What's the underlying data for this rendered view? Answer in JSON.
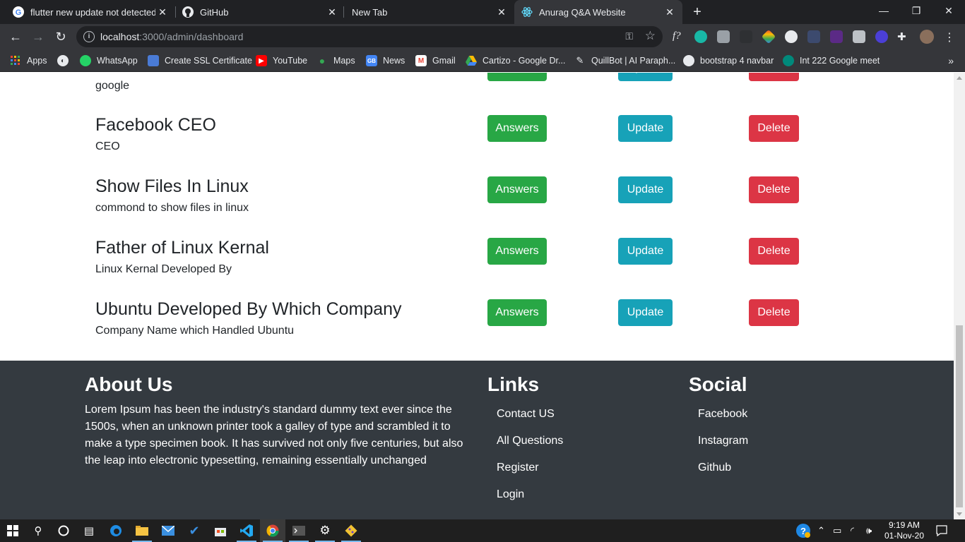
{
  "browser": {
    "tabs": [
      {
        "title": "flutter new update not detected",
        "icon": "google-icon",
        "active": false
      },
      {
        "title": "GitHub",
        "icon": "github-icon",
        "active": false
      },
      {
        "title": "New Tab",
        "icon": "",
        "active": false
      },
      {
        "title": "Anurag Q&A Website",
        "icon": "react-icon",
        "active": true
      }
    ],
    "url_host": "localhost",
    "url_path": ":3000/admin/dashboard",
    "bookmarks": [
      {
        "label": "Apps",
        "icon": "apps-grid-icon"
      },
      {
        "label": "",
        "icon": "globe-icon"
      },
      {
        "label": "WhatsApp",
        "icon": "whatsapp-icon"
      },
      {
        "label": "Create SSL Certificate",
        "icon": "puzzle-icon"
      },
      {
        "label": "YouTube",
        "icon": "youtube-icon"
      },
      {
        "label": "Maps",
        "icon": "maps-pin-icon"
      },
      {
        "label": "News",
        "icon": "news-icon"
      },
      {
        "label": "Gmail",
        "icon": "gmail-icon"
      },
      {
        "label": "Cartizo - Google Dr...",
        "icon": "google-drive-icon"
      },
      {
        "label": "QuillBot | AI Paraph...",
        "icon": "quill-icon"
      },
      {
        "label": "bootstrap 4 navbar",
        "icon": "github-icon"
      },
      {
        "label": "Int 222 Google meet",
        "icon": "meet-icon"
      }
    ]
  },
  "questions": [
    {
      "title": "",
      "desc": "google"
    },
    {
      "title": "Facebook CEO",
      "desc": "CEO"
    },
    {
      "title": "Show Files In Linux",
      "desc": "commond to show files in linux"
    },
    {
      "title": "Father of Linux Kernal",
      "desc": "Linux Kernal Developed By"
    },
    {
      "title": "Ubuntu Developed By Which Company",
      "desc": "Company Name which Handled Ubuntu"
    }
  ],
  "buttons": {
    "answers": "Answers",
    "update": "Update",
    "delete": "Delete"
  },
  "footer": {
    "about_title": "About Us",
    "about_text": "Lorem Ipsum has been the industry's standard dummy text ever since the 1500s, when an unknown printer took a galley of type and scrambled it to make a type specimen book. It has survived not only five centuries, but also the leap into electronic typesetting, remaining essentially unchanged",
    "links_title": "Links",
    "links": [
      "Contact US",
      "All Questions",
      "Register",
      "Login"
    ],
    "social_title": "Social",
    "social": [
      "Facebook",
      "Instagram",
      "Github"
    ]
  },
  "taskbar": {
    "time": "9:19 AM",
    "date": "01-Nov-20"
  },
  "colors": {
    "answers": "#28a745",
    "update": "#17a2b8",
    "delete": "#dc3545",
    "footer": "#343a40",
    "chrome_dark": "#202124",
    "chrome_toolbar": "#35363a"
  }
}
